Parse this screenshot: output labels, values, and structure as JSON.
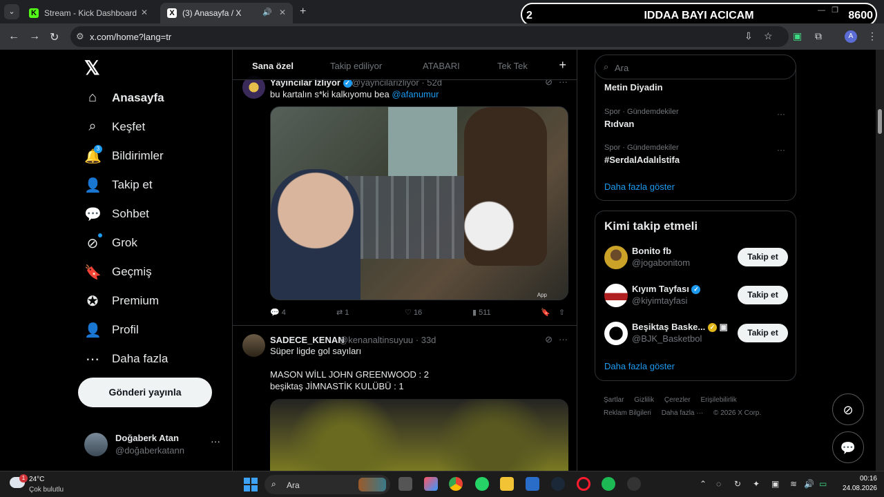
{
  "browser": {
    "tabs": [
      {
        "title": "Stream - Kick Dashboard",
        "favicon": "K"
      },
      {
        "title": "(3) Anasayfa / X",
        "favicon": "X"
      }
    ],
    "url": "x.com/home?lang=tr",
    "profile_initial": "A"
  },
  "stream_overlay": {
    "number": "2",
    "message": "IDDAA BAYI ACICAM",
    "counter": "8600"
  },
  "x_logo": "𝕏",
  "nav": {
    "items": [
      {
        "label": "Anasayfa",
        "icon": "⌂"
      },
      {
        "label": "Keşfet",
        "icon": "⌕"
      },
      {
        "label": "Bildirimler",
        "icon": "🔔",
        "badge": "3"
      },
      {
        "label": "Takip et",
        "icon": "👤"
      },
      {
        "label": "Sohbet",
        "icon": "💬"
      },
      {
        "label": "Grok",
        "icon": "⊘"
      },
      {
        "label": "Geçmiş",
        "icon": "🔖"
      },
      {
        "label": "Premium",
        "icon": "✪"
      },
      {
        "label": "Profil",
        "icon": "👤"
      },
      {
        "label": "Daha fazla",
        "icon": "⋯"
      }
    ],
    "post_button": "Gönderi yayınla"
  },
  "account": {
    "name": "Doğaberk Atan",
    "handle": "@doğaberkatann",
    "more": "···"
  },
  "feed": {
    "tabs": [
      "Sana özel",
      "Takip ediliyor",
      "ATABARI",
      "Tek Tek"
    ],
    "plus": "+",
    "tweet1": {
      "name": "Yayıncılar İzliyor",
      "handle": "@yayncilarizliyor · 52d",
      "text": "bu kartalın s*ki kalkıyomu bea",
      "mention": "@afanumur",
      "media_label": "App",
      "replies": "4",
      "retweets": "1",
      "likes": "16",
      "views": "511"
    },
    "tweet2": {
      "name": "SADECE_KENAN",
      "handle": "@kenanaltinsuyuu · 33d",
      "text": "Süper ligde gol sayıları\n\nMASON WİLL JOHN GREENWOOD : 2\nbeşiktaş JİMNASTİK KULÜBÜ : 1"
    }
  },
  "sidebar": {
    "search_placeholder": "Ara",
    "trend_top": "Metin Diyadin",
    "trends": [
      {
        "category": "Spor · Gündemdekiler",
        "title": "Rıdvan"
      },
      {
        "category": "Spor · Gündemdekiler",
        "title": "#SerdalAdalıİstifa"
      }
    ],
    "show_more": "Daha fazla göster",
    "who_title": "Kimi takip etmeli",
    "who": [
      {
        "name": "Bonito fb",
        "handle": "@jogabonitom",
        "button": "Takip et"
      },
      {
        "name": "Kıyım Tayfası",
        "handle": "@kiyimtayfasi",
        "button": "Takip et"
      },
      {
        "name": "Beşiktaş Baske...",
        "handle": "@BJK_Basketbol",
        "button": "Takip et"
      }
    ],
    "who_show_more": "Daha fazla göster",
    "footer": [
      "Şartlar",
      "Gizlilik",
      "Çerezler",
      "Erişilebilirlik",
      "Reklam Bilgileri",
      "Daha fazla ···",
      "© 2026 X Corp."
    ]
  },
  "taskbar": {
    "weather_temp": "24°C",
    "weather_desc": "Çok bulutlu",
    "weather_badge": "1",
    "search_placeholder": "Ara",
    "time": "00:16",
    "date": "24.08.2026"
  },
  "colors": {
    "accent": "#1d9bf0",
    "background": "#000000",
    "border": "#2f3336"
  }
}
